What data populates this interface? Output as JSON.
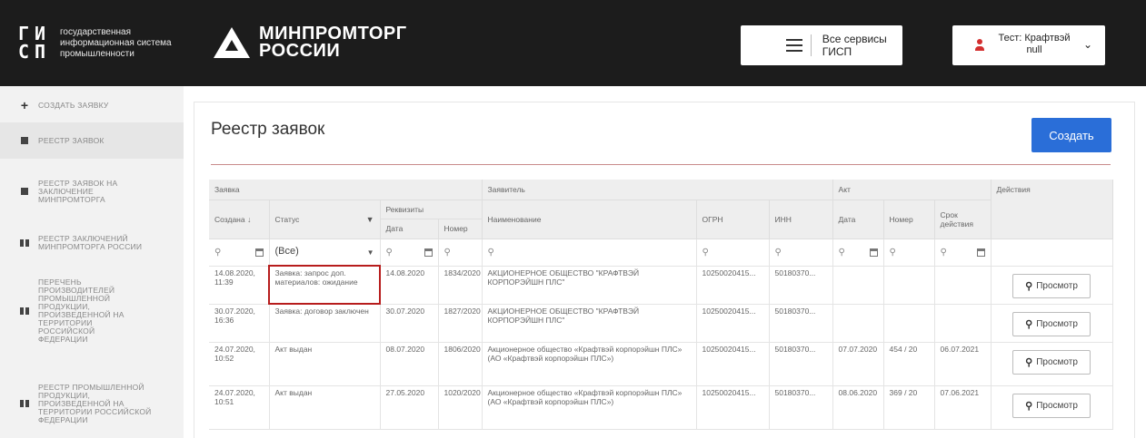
{
  "header": {
    "gisp_mark": [
      "Г",
      "И",
      "С",
      "П"
    ],
    "gisp_text": [
      "государственная",
      "информационная система",
      "промышленности"
    ],
    "ministry": [
      "МИНПРОМТОРГ",
      "РОССИИ"
    ],
    "services_label": "Все сервисы ГИСП",
    "user_name": "Тест: Крафтвэй null"
  },
  "sidebar": {
    "items": [
      {
        "label": "СОЗДАТЬ ЗАЯВКУ",
        "icon": "plus-icon"
      },
      {
        "label": "РЕЕСТР ЗАЯВОК",
        "icon": "square-icon"
      },
      {
        "label": "РЕЕСТР ЗАЯВОК НА ЗАКЛЮЧЕНИЕ МИНПРОМТОРГА",
        "icon": "square-icon"
      },
      {
        "label": "РЕЕСТР ЗАКЛЮЧЕНИЙ МИНПРОМТОРГА РОССИИ",
        "icon": "book-icon"
      },
      {
        "label": "ПЕРЕЧЕНЬ ПРОИЗВОДИТЕЛЕЙ ПРОМЫШЛЕННОЙ ПРОДУКЦИИ, ПРОИЗВЕДЕННОЙ НА ТЕРРИТОРИИ РОССИЙСКОЙ ФЕДЕРАЦИИ",
        "icon": "book-icon"
      },
      {
        "label": "РЕЕСТР ПРОМЫШЛЕННОЙ ПРОДУКЦИИ, ПРОИЗВЕДЕННОЙ НА ТЕРРИТОРИИ РОССИЙСКОЙ ФЕДЕРАЦИИ",
        "icon": "book-icon"
      }
    ]
  },
  "main": {
    "title": "Реестр заявок",
    "create_label": "Создать"
  },
  "table": {
    "groups": {
      "request": "Заявка",
      "applicant": "Заявитель",
      "act": "Акт",
      "actions": "Действия"
    },
    "columns": {
      "created": "Создана",
      "status": "Статус",
      "requisites": "Реквизиты",
      "date": "Дата",
      "number": "Номер",
      "name": "Наименование",
      "ogrn": "ОГРН",
      "inn": "ИНН",
      "act_date": "Дата",
      "act_number": "Номер",
      "act_validity": "Срок действия"
    },
    "status_filter": "(Все)",
    "view_label": "Просмотр",
    "rows": [
      {
        "created": "14.08.2020, 11:39",
        "status": "Заявка: запрос доп. материалов: ожидание",
        "req_date": "14.08.2020",
        "req_num": "1834/2020",
        "name": "АКЦИОНЕРНОЕ ОБЩЕСТВО \"КРАФТВЭЙ КОРПОРЭЙШН ПЛС\"",
        "ogrn": "10250020415...",
        "inn": "50180370...",
        "act_date": "",
        "act_num": "",
        "act_valid": ""
      },
      {
        "created": "30.07.2020, 16:36",
        "status": "Заявка: договор заключен",
        "req_date": "30.07.2020",
        "req_num": "1827/2020",
        "name": "АКЦИОНЕРНОЕ ОБЩЕСТВО \"КРАФТВЭЙ КОРПОРЭЙШН ПЛС\"",
        "ogrn": "10250020415...",
        "inn": "50180370...",
        "act_date": "",
        "act_num": "",
        "act_valid": ""
      },
      {
        "created": "24.07.2020, 10:52",
        "status": "Акт выдан",
        "req_date": "08.07.2020",
        "req_num": "1806/2020",
        "name": "Акционерное общество «Крафтвэй корпорэйшн ПЛС» (АО «Крафтвэй корпорэйшн ПЛС»)",
        "ogrn": "10250020415...",
        "inn": "50180370...",
        "act_date": "07.07.2020",
        "act_num": "454 / 20",
        "act_valid": "06.07.2021"
      },
      {
        "created": "24.07.2020, 10:51",
        "status": "Акт выдан",
        "req_date": "27.05.2020",
        "req_num": "1020/2020",
        "name": "Акционерное общество «Крафтвэй корпорэйшн ПЛС» (АО «Крафтвэй корпорэйшн ПЛС»)",
        "ogrn": "10250020415...",
        "inn": "50180370...",
        "act_date": "08.06.2020",
        "act_num": "369 / 20",
        "act_valid": "07.06.2021"
      }
    ]
  },
  "colors": {
    "header_bg": "#1c1c1c",
    "accent_blue": "#2a6ed8",
    "highlight_red": "#b71c1c",
    "sidebar_bg": "#f2f2f2"
  }
}
